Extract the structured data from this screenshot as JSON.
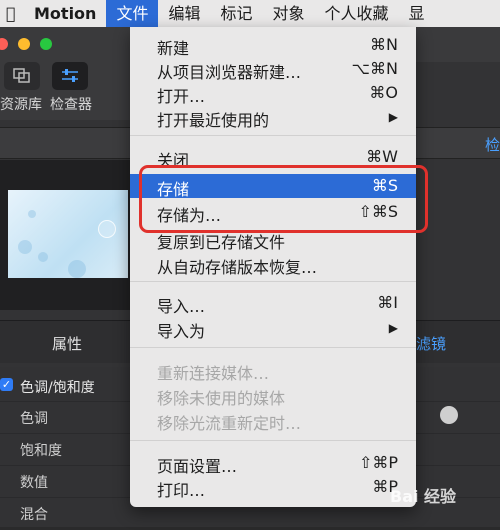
{
  "menubar": {
    "app_name": "Motion",
    "items": [
      "文件",
      "编辑",
      "标记",
      "对象",
      "个人收藏",
      "显"
    ]
  },
  "toolbar": {
    "library_label": "资源库",
    "inspector_label": "检查器"
  },
  "header_right": "检",
  "tabs": {
    "properties": "属性",
    "filters_partial": "滤镜"
  },
  "params": {
    "group_label": "色调/饱和度",
    "rows": [
      "色调",
      "饱和度",
      "数值",
      "混合"
    ]
  },
  "file_menu": {
    "items": [
      {
        "label": "新建",
        "shortcut": "⌘N"
      },
      {
        "label": "从项目浏览器新建…",
        "shortcut": "⌥⌘N"
      },
      {
        "label": "打开…",
        "shortcut": "⌘O"
      },
      {
        "label": "打开最近使用的",
        "shortcut": "▶"
      },
      {
        "label": "关闭",
        "shortcut": "⌘W"
      },
      {
        "label": "存储",
        "shortcut": "⌘S"
      },
      {
        "label": "存储为…",
        "shortcut": "⇧⌘S"
      },
      {
        "label": "复原到已存储文件",
        "shortcut": ""
      },
      {
        "label": "从自动存储版本恢复…",
        "shortcut": ""
      },
      {
        "label": "导入…",
        "shortcut": "⌘I"
      },
      {
        "label": "导入为",
        "shortcut": "▶"
      },
      {
        "label": "重新连接媒体…",
        "shortcut": ""
      },
      {
        "label": "移除未使用的媒体",
        "shortcut": ""
      },
      {
        "label": "移除光流重新定时…",
        "shortcut": ""
      },
      {
        "label": "页面设置…",
        "shortcut": "⇧⌘P"
      },
      {
        "label": "打印…",
        "shortcut": "⌘P"
      }
    ]
  },
  "watermark": "Bai 经验",
  "colors": {
    "accent": "#2c6bd6",
    "highlight_border": "#e0312c"
  }
}
